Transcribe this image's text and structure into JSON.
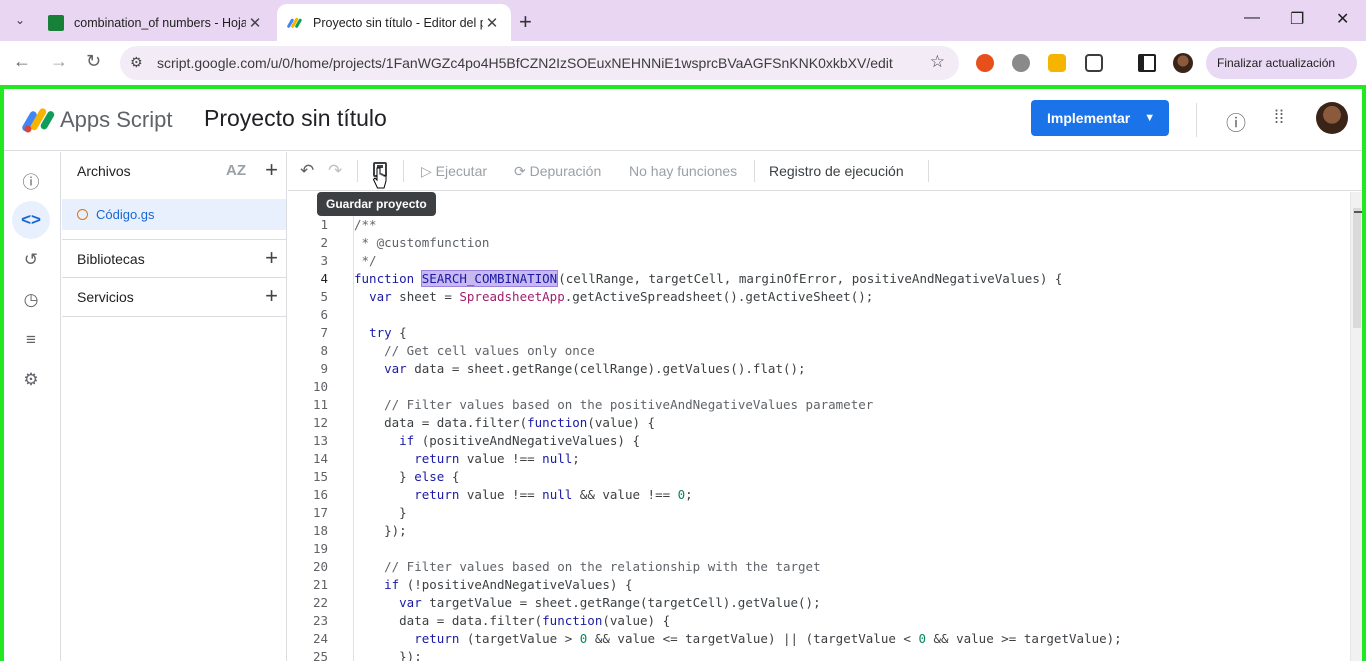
{
  "browser": {
    "tabs": [
      {
        "title": "combination_of numbers - Hoja",
        "favicon_color": "#188038"
      },
      {
        "title": "Proyecto sin título - Editor del p",
        "favicon_color": "#f4b400"
      }
    ],
    "url": "script.google.com/u/0/home/projects/1FanWGZc4po4H5BfCZN2IzSOEuxNEHNNiE1wsprcBVaAGFSnKNK0xkbXV/edit",
    "update_label": "Finalizar actualización"
  },
  "app": {
    "name": "Apps Script",
    "project_title": "Proyecto sin título",
    "deploy_label": "Implementar"
  },
  "files_panel": {
    "files_label": "Archivos",
    "az_label": "AZ",
    "file_name": "Código.gs",
    "libraries_label": "Bibliotecas",
    "services_label": "Servicios"
  },
  "editor_toolbar": {
    "run_label": "Ejecutar",
    "debug_label": "Depuración",
    "no_functions_label": "No hay funciones",
    "exec_log_label": "Registro de ejecución",
    "tooltip": "Guardar proyecto"
  },
  "code": {
    "current_line": 4,
    "lines": [
      {
        "n": "1",
        "html": "<span class=\"cm\">/**</span>"
      },
      {
        "n": "2",
        "html": "<span class=\"cm\"> * @customfunction</span>"
      },
      {
        "n": "3",
        "html": "<span class=\"cm\"> */</span>"
      },
      {
        "n": "4",
        "html": "<span class=\"kw\">function</span> <span class=\"hl\">SEARCH_COMBINATION</span><span class=\"caret-bar\"></span>(cellRange, targetCell, marginOfError, positiveAndNegativeValues) {"
      },
      {
        "n": "5",
        "html": "  <span class=\"kw\">var</span> sheet = <span class=\"cls\">SpreadsheetApp</span>.getActiveSpreadsheet().getActiveSheet();"
      },
      {
        "n": "6",
        "html": ""
      },
      {
        "n": "7",
        "html": "  <span class=\"kw\">try</span> {"
      },
      {
        "n": "8",
        "html": "    <span class=\"cm\">// Get cell values only once</span>"
      },
      {
        "n": "9",
        "html": "    <span class=\"kw\">var</span> data = sheet.getRange(cellRange).getValues().flat();"
      },
      {
        "n": "10",
        "html": ""
      },
      {
        "n": "11",
        "html": "    <span class=\"cm\">// Filter values based on the positiveAndNegativeValues parameter</span>"
      },
      {
        "n": "12",
        "html": "    data = data.filter(<span class=\"kw\">function</span>(value) {"
      },
      {
        "n": "13",
        "html": "      <span class=\"kw\">if</span> (positiveAndNegativeValues) {"
      },
      {
        "n": "14",
        "html": "        <span class=\"kw\">return</span> value !== <span class=\"kw\">null</span>;"
      },
      {
        "n": "15",
        "html": "      } <span class=\"kw\">else</span> {"
      },
      {
        "n": "16",
        "html": "        <span class=\"kw\">return</span> value !== <span class=\"kw\">null</span> &amp;&amp; value !== <span class=\"num\">0</span>;"
      },
      {
        "n": "17",
        "html": "      }"
      },
      {
        "n": "18",
        "html": "    });"
      },
      {
        "n": "19",
        "html": ""
      },
      {
        "n": "20",
        "html": "    <span class=\"cm\">// Filter values based on the relationship with the target</span>"
      },
      {
        "n": "21",
        "html": "    <span class=\"kw\">if</span> (!positiveAndNegativeValues) {"
      },
      {
        "n": "22",
        "html": "      <span class=\"kw\">var</span> targetValue = sheet.getRange(targetCell).getValue();"
      },
      {
        "n": "23",
        "html": "      data = data.filter(<span class=\"kw\">function</span>(value) {"
      },
      {
        "n": "24",
        "html": "        <span class=\"kw\">return</span> (targetValue &gt; <span class=\"num\">0</span> &amp;&amp; value &lt;= targetValue) || (targetValue &lt; <span class=\"num\">0</span> &amp;&amp; value &gt;= targetValue);"
      },
      {
        "n": "25",
        "html": "      });"
      }
    ]
  },
  "colors": {
    "accent": "#1a73e8",
    "frame": "#22e822",
    "tabstrip": "#e8d6f3"
  }
}
